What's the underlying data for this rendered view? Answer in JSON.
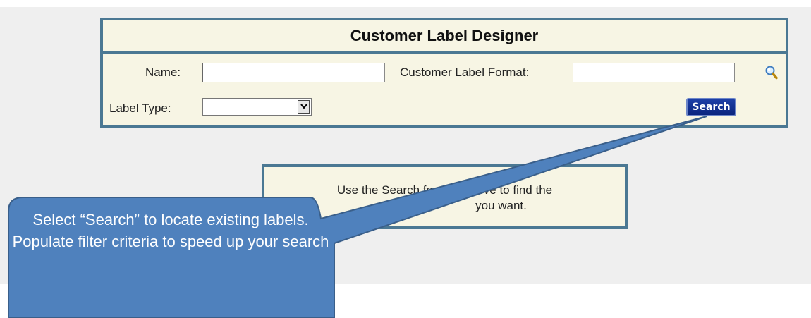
{
  "panel": {
    "title": "Customer Label Designer",
    "name_label": "Name:",
    "name_value": "",
    "format_label": "Customer Label Format:",
    "format_value": "",
    "label_type_label": "Label Type:",
    "label_type_value": "",
    "search_button": "Search"
  },
  "message": {
    "line1": "Use the Search feature above to find the",
    "line2": "you want."
  },
  "callout": {
    "text": "Select “Search” to locate existing labels. Populate filter criteria to speed up your search"
  },
  "colors": {
    "panel_border": "#4b7893",
    "panel_bg": "#f7f5e4",
    "button_bg": "#0a247e",
    "callout_fill": "#4f81bd",
    "callout_border": "#3a5f8a"
  },
  "icons": {
    "lookup": "magnifier-icon",
    "dropdown": "chevron-down-icon"
  }
}
